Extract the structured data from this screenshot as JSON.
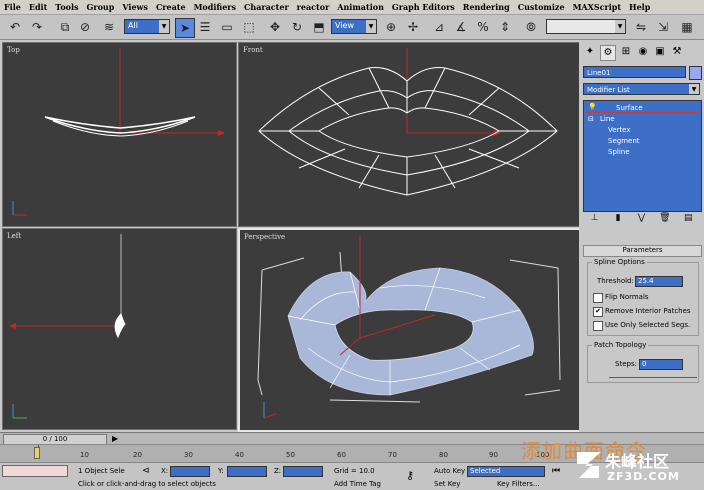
{
  "menu": [
    "File",
    "Edit",
    "Tools",
    "Group",
    "Views",
    "Create",
    "Modifiers",
    "Character",
    "reactor",
    "Animation",
    "Graph Editors",
    "Rendering",
    "Customize",
    "MAXScript",
    "Help"
  ],
  "toolbar": {
    "selection_filter": "All",
    "ref_coord": "View"
  },
  "viewports": {
    "top": "Top",
    "front": "Front",
    "left": "Left",
    "perspective": "Perspective"
  },
  "command_panel": {
    "object_name": "Line01",
    "object_color": "#9aa8f0",
    "modifier_list": "Modifier List",
    "stack": {
      "surface": "Surface",
      "line": "Line",
      "vertex": "Vertex",
      "segment": "Segment",
      "spline": "Spline"
    },
    "parameters_title": "Parameters",
    "spline_options": "Spline Options",
    "threshold_label": "Threshold:",
    "threshold_value": "25.4",
    "flip_normals": "Flip Normals",
    "remove_interior": "Remove Interior Patches",
    "use_only_selected": "Use Only Selected Segs.",
    "patch_topology": "Patch Topology",
    "steps_label": "Steps:",
    "steps_value": "0"
  },
  "timeline": {
    "frame": "0 / 100",
    "ticks": [
      "10",
      "20",
      "30",
      "40",
      "50",
      "60",
      "70",
      "80",
      "90",
      "100"
    ]
  },
  "status": {
    "selected_count": "1 Object Sele",
    "x_label": "X:",
    "y_label": "Y:",
    "z_label": "Z:",
    "grid": "Grid = 10.0",
    "auto_key": "Auto Key",
    "key_mode": "Selected",
    "set_key": "Set Key",
    "key_filters": "Key Filters...",
    "prompt": "Click or click-and-drag to select objects",
    "add_time_tag": "Add Time Tag"
  },
  "overlay_caption": "添加曲面命令",
  "watermark": {
    "site_cn": "朱峰社区",
    "site_url": "ZF3D.COM"
  }
}
